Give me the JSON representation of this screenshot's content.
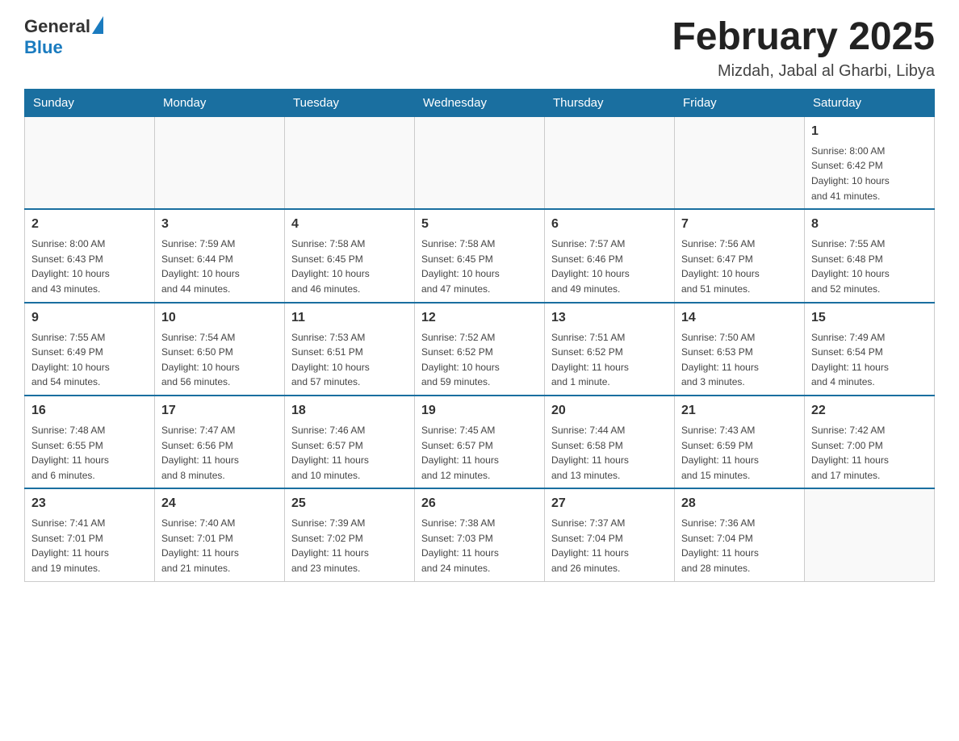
{
  "logo": {
    "general": "General",
    "blue": "Blue"
  },
  "title": "February 2025",
  "location": "Mizdah, Jabal al Gharbi, Libya",
  "days_of_week": [
    "Sunday",
    "Monday",
    "Tuesday",
    "Wednesday",
    "Thursday",
    "Friday",
    "Saturday"
  ],
  "weeks": [
    [
      {
        "day": "",
        "info": ""
      },
      {
        "day": "",
        "info": ""
      },
      {
        "day": "",
        "info": ""
      },
      {
        "day": "",
        "info": ""
      },
      {
        "day": "",
        "info": ""
      },
      {
        "day": "",
        "info": ""
      },
      {
        "day": "1",
        "info": "Sunrise: 8:00 AM\nSunset: 6:42 PM\nDaylight: 10 hours\nand 41 minutes."
      }
    ],
    [
      {
        "day": "2",
        "info": "Sunrise: 8:00 AM\nSunset: 6:43 PM\nDaylight: 10 hours\nand 43 minutes."
      },
      {
        "day": "3",
        "info": "Sunrise: 7:59 AM\nSunset: 6:44 PM\nDaylight: 10 hours\nand 44 minutes."
      },
      {
        "day": "4",
        "info": "Sunrise: 7:58 AM\nSunset: 6:45 PM\nDaylight: 10 hours\nand 46 minutes."
      },
      {
        "day": "5",
        "info": "Sunrise: 7:58 AM\nSunset: 6:45 PM\nDaylight: 10 hours\nand 47 minutes."
      },
      {
        "day": "6",
        "info": "Sunrise: 7:57 AM\nSunset: 6:46 PM\nDaylight: 10 hours\nand 49 minutes."
      },
      {
        "day": "7",
        "info": "Sunrise: 7:56 AM\nSunset: 6:47 PM\nDaylight: 10 hours\nand 51 minutes."
      },
      {
        "day": "8",
        "info": "Sunrise: 7:55 AM\nSunset: 6:48 PM\nDaylight: 10 hours\nand 52 minutes."
      }
    ],
    [
      {
        "day": "9",
        "info": "Sunrise: 7:55 AM\nSunset: 6:49 PM\nDaylight: 10 hours\nand 54 minutes."
      },
      {
        "day": "10",
        "info": "Sunrise: 7:54 AM\nSunset: 6:50 PM\nDaylight: 10 hours\nand 56 minutes."
      },
      {
        "day": "11",
        "info": "Sunrise: 7:53 AM\nSunset: 6:51 PM\nDaylight: 10 hours\nand 57 minutes."
      },
      {
        "day": "12",
        "info": "Sunrise: 7:52 AM\nSunset: 6:52 PM\nDaylight: 10 hours\nand 59 minutes."
      },
      {
        "day": "13",
        "info": "Sunrise: 7:51 AM\nSunset: 6:52 PM\nDaylight: 11 hours\nand 1 minute."
      },
      {
        "day": "14",
        "info": "Sunrise: 7:50 AM\nSunset: 6:53 PM\nDaylight: 11 hours\nand 3 minutes."
      },
      {
        "day": "15",
        "info": "Sunrise: 7:49 AM\nSunset: 6:54 PM\nDaylight: 11 hours\nand 4 minutes."
      }
    ],
    [
      {
        "day": "16",
        "info": "Sunrise: 7:48 AM\nSunset: 6:55 PM\nDaylight: 11 hours\nand 6 minutes."
      },
      {
        "day": "17",
        "info": "Sunrise: 7:47 AM\nSunset: 6:56 PM\nDaylight: 11 hours\nand 8 minutes."
      },
      {
        "day": "18",
        "info": "Sunrise: 7:46 AM\nSunset: 6:57 PM\nDaylight: 11 hours\nand 10 minutes."
      },
      {
        "day": "19",
        "info": "Sunrise: 7:45 AM\nSunset: 6:57 PM\nDaylight: 11 hours\nand 12 minutes."
      },
      {
        "day": "20",
        "info": "Sunrise: 7:44 AM\nSunset: 6:58 PM\nDaylight: 11 hours\nand 13 minutes."
      },
      {
        "day": "21",
        "info": "Sunrise: 7:43 AM\nSunset: 6:59 PM\nDaylight: 11 hours\nand 15 minutes."
      },
      {
        "day": "22",
        "info": "Sunrise: 7:42 AM\nSunset: 7:00 PM\nDaylight: 11 hours\nand 17 minutes."
      }
    ],
    [
      {
        "day": "23",
        "info": "Sunrise: 7:41 AM\nSunset: 7:01 PM\nDaylight: 11 hours\nand 19 minutes."
      },
      {
        "day": "24",
        "info": "Sunrise: 7:40 AM\nSunset: 7:01 PM\nDaylight: 11 hours\nand 21 minutes."
      },
      {
        "day": "25",
        "info": "Sunrise: 7:39 AM\nSunset: 7:02 PM\nDaylight: 11 hours\nand 23 minutes."
      },
      {
        "day": "26",
        "info": "Sunrise: 7:38 AM\nSunset: 7:03 PM\nDaylight: 11 hours\nand 24 minutes."
      },
      {
        "day": "27",
        "info": "Sunrise: 7:37 AM\nSunset: 7:04 PM\nDaylight: 11 hours\nand 26 minutes."
      },
      {
        "day": "28",
        "info": "Sunrise: 7:36 AM\nSunset: 7:04 PM\nDaylight: 11 hours\nand 28 minutes."
      },
      {
        "day": "",
        "info": ""
      }
    ]
  ]
}
